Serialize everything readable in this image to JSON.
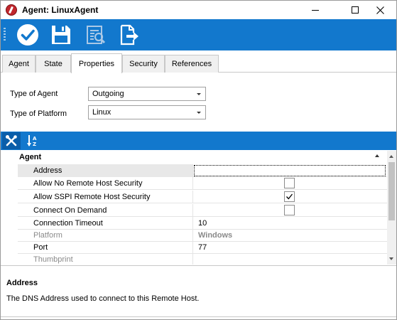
{
  "window": {
    "title": "Agent: LinuxAgent",
    "controls": [
      "minimize",
      "maximize",
      "close"
    ]
  },
  "toolbar": {
    "buttons": [
      {
        "name": "ok",
        "icon": "checkmark-circle-icon"
      },
      {
        "name": "save",
        "icon": "floppy-disk-icon"
      },
      {
        "name": "preview",
        "icon": "document-search-icon"
      },
      {
        "name": "export",
        "icon": "document-export-icon"
      }
    ]
  },
  "tabs": [
    {
      "label": "Agent"
    },
    {
      "label": "State"
    },
    {
      "label": "Properties",
      "active": true
    },
    {
      "label": "Security"
    },
    {
      "label": "References"
    }
  ],
  "form": {
    "type_of_agent": {
      "label": "Type of Agent",
      "value": "Outgoing"
    },
    "type_of_platform": {
      "label": "Type of Platform",
      "value": "Linux"
    }
  },
  "property_grid": {
    "toolbar": [
      {
        "name": "categorized",
        "icon": "wrench-screwdriver-icon",
        "active": true
      },
      {
        "name": "alphabetical",
        "icon": "sort-az-icon",
        "active": false
      }
    ],
    "category": "Agent",
    "rows": [
      {
        "name": "Address",
        "value": "",
        "selected": true
      },
      {
        "name": "Allow No Remote Host Security",
        "checked": false
      },
      {
        "name": "Allow SSPI Remote Host Security",
        "checked": true
      },
      {
        "name": "Connect On Demand",
        "checked": false
      },
      {
        "name": "Connection Timeout",
        "value": "10"
      },
      {
        "name": "Platform",
        "value": "Windows",
        "disabled": true
      },
      {
        "name": "Port",
        "value": "77"
      },
      {
        "name": "Thumbprint",
        "value": "",
        "disabled": true
      }
    ]
  },
  "description": {
    "title": "Address",
    "text": "The DNS Address used to connect to this Remote Host."
  },
  "colors": {
    "toolbar_blue": "#1278cd",
    "title_icon_red": "#c1272d"
  }
}
